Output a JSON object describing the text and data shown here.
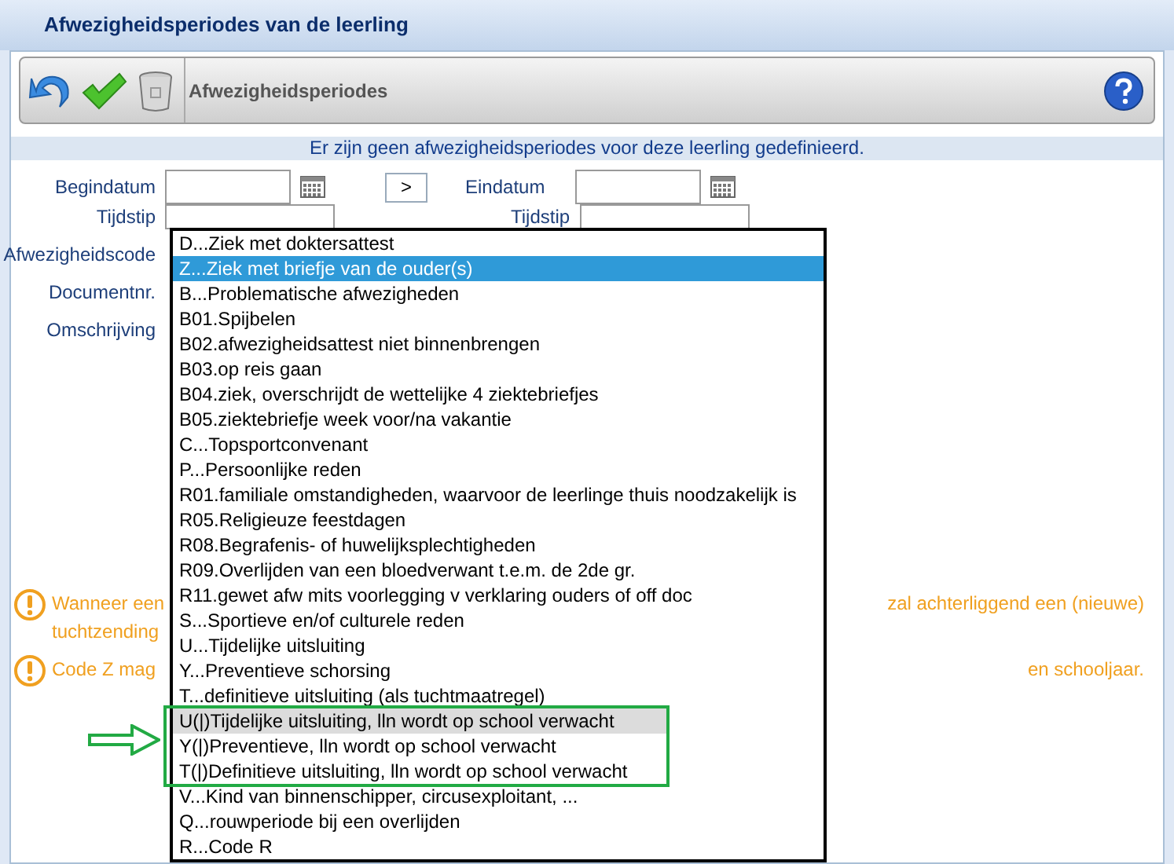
{
  "window": {
    "title": "Afwezigheidsperiodes van de leerling"
  },
  "toolbar": {
    "title": "Afwezigheidsperiodes"
  },
  "info": "Er zijn geen afwezigheidsperiodes voor deze leerling gedefinieerd.",
  "form": {
    "begindatum": {
      "label": "Begindatum"
    },
    "next": ">",
    "einddatum": {
      "label": "Eindatum"
    },
    "tijdstip_left": {
      "label": "Tijdstip"
    },
    "tijdstip_right": {
      "label": "Tijdstip"
    },
    "labels": [
      "Afwezigheidscode",
      "Documentnr.",
      "Omschrijving"
    ]
  },
  "warnings": [
    {
      "left": "Wanneer een",
      "right": "zal achterliggend een (nieuwe)",
      "second_line": "tuchtzending"
    },
    {
      "left": "Code Z mag",
      "right": "en schooljaar."
    }
  ],
  "dropdown": [
    {
      "text": "D...Ziek met doktersattest",
      "selected": false,
      "hovered": false,
      "highlighted": false
    },
    {
      "text": "Z...Ziek met briefje van de ouder(s)",
      "selected": true,
      "hovered": false,
      "highlighted": false
    },
    {
      "text": "B...Problematische afwezigheden",
      "selected": false,
      "hovered": false,
      "highlighted": false
    },
    {
      "text": "B01.Spijbelen",
      "selected": false,
      "hovered": false,
      "highlighted": false
    },
    {
      "text": "B02.afwezigheidsattest niet binnenbrengen",
      "selected": false,
      "hovered": false,
      "highlighted": false
    },
    {
      "text": "B03.op reis gaan",
      "selected": false,
      "hovered": false,
      "highlighted": false
    },
    {
      "text": "B04.ziek, overschrijdt de wettelijke 4 ziektebriefjes",
      "selected": false,
      "hovered": false,
      "highlighted": false
    },
    {
      "text": "B05.ziektebriefje week voor/na vakantie",
      "selected": false,
      "hovered": false,
      "highlighted": false
    },
    {
      "text": "C...Topsportconvenant",
      "selected": false,
      "hovered": false,
      "highlighted": false
    },
    {
      "text": "P...Persoonlijke reden",
      "selected": false,
      "hovered": false,
      "highlighted": false
    },
    {
      "text": "R01.familiale omstandigheden, waarvoor de leerlinge thuis noodzakelijk is",
      "selected": false,
      "hovered": false,
      "highlighted": false
    },
    {
      "text": "R05.Religieuze feestdagen",
      "selected": false,
      "hovered": false,
      "highlighted": false
    },
    {
      "text": "R08.Begrafenis- of huwelijksplechtigheden",
      "selected": false,
      "hovered": false,
      "highlighted": false
    },
    {
      "text": "R09.Overlijden van een bloedverwant t.e.m. de 2de gr.",
      "selected": false,
      "hovered": false,
      "highlighted": false
    },
    {
      "text": "R11.gewet afw mits voorlegging v verklaring ouders of off doc",
      "selected": false,
      "hovered": false,
      "highlighted": false
    },
    {
      "text": "S...Sportieve en/of culturele reden",
      "selected": false,
      "hovered": false,
      "highlighted": false
    },
    {
      "text": "U...Tijdelijke uitsluiting",
      "selected": false,
      "hovered": false,
      "highlighted": false
    },
    {
      "text": "Y...Preventieve schorsing",
      "selected": false,
      "hovered": false,
      "highlighted": false
    },
    {
      "text": "T...definitieve uitsluiting (als tuchtmaatregel)",
      "selected": false,
      "hovered": false,
      "highlighted": false
    },
    {
      "text": "U(|)Tijdelijke uitsluiting, lln wordt op school verwacht",
      "selected": false,
      "hovered": true,
      "highlighted": true
    },
    {
      "text": "Y(|)Preventieve, lln wordt op school verwacht",
      "selected": false,
      "hovered": false,
      "highlighted": true
    },
    {
      "text": "T(|)Definitieve uitsluiting, lln wordt op school verwacht",
      "selected": false,
      "hovered": false,
      "highlighted": true
    },
    {
      "text": "V...Kind van binnenschipper, circusexploitant, ...",
      "selected": false,
      "hovered": false,
      "highlighted": false
    },
    {
      "text": "Q...rouwperiode bij een overlijden",
      "selected": false,
      "hovered": false,
      "highlighted": false
    },
    {
      "text": "R...Code R",
      "selected": false,
      "hovered": false,
      "highlighted": false
    }
  ]
}
